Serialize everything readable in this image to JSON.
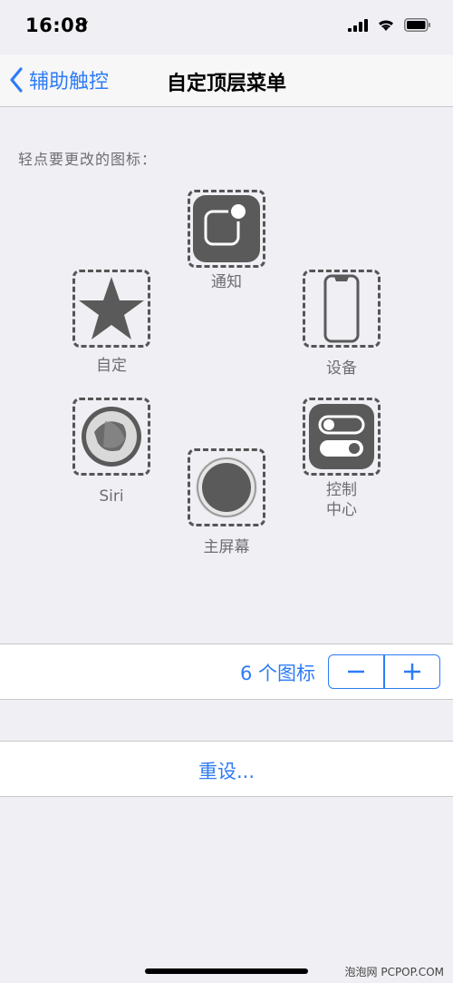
{
  "status_bar": {
    "time": "16:08"
  },
  "nav": {
    "back_label": "辅助触控",
    "title": "自定顶层菜单"
  },
  "instruction": "轻点要更改的图标：",
  "slots": {
    "notification": {
      "label": "通知",
      "icon": "notification-icon"
    },
    "custom": {
      "label": "自定",
      "icon": "star-icon"
    },
    "device": {
      "label": "设备",
      "icon": "device-icon"
    },
    "siri": {
      "label": "Siri",
      "icon": "siri-icon"
    },
    "control_center": {
      "label": "控制\n中心",
      "icon": "control-center-icon"
    },
    "home": {
      "label": "主屏幕",
      "icon": "home-button-icon"
    }
  },
  "icon_count": {
    "label": "6 个图标",
    "minus": "−",
    "plus": "+"
  },
  "reset": {
    "label": "重设..."
  },
  "watermark": "泡泡网 PCPOP.COM",
  "colors": {
    "accent": "#2e7cf6",
    "icon_fill": "#5a5a5a",
    "background": "#efeff4"
  }
}
